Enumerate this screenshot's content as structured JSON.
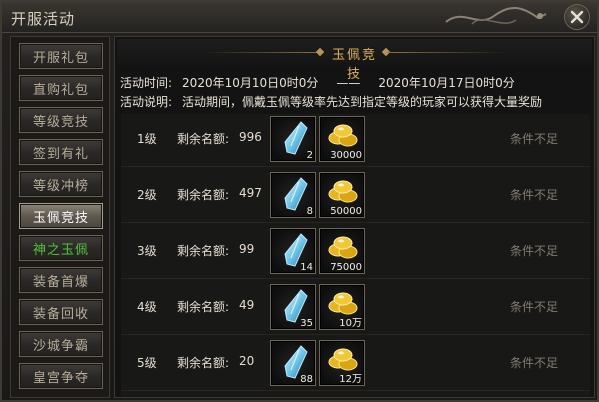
{
  "window": {
    "title": "开服活动"
  },
  "sidebar": {
    "items": [
      {
        "label": "开服礼包",
        "active": false,
        "highlight": false
      },
      {
        "label": "直购礼包",
        "active": false,
        "highlight": false
      },
      {
        "label": "等级竞技",
        "active": false,
        "highlight": false
      },
      {
        "label": "签到有礼",
        "active": false,
        "highlight": false
      },
      {
        "label": "等级冲榜",
        "active": false,
        "highlight": false
      },
      {
        "label": "玉佩竞技",
        "active": true,
        "highlight": false
      },
      {
        "label": "神之玉佩",
        "active": false,
        "highlight": true
      },
      {
        "label": "装备首爆",
        "active": false,
        "highlight": false
      },
      {
        "label": "装备回收",
        "active": false,
        "highlight": false
      },
      {
        "label": "沙城争霸",
        "active": false,
        "highlight": false
      },
      {
        "label": "皇宫争夺",
        "active": false,
        "highlight": false
      }
    ]
  },
  "main": {
    "banner_title": "玉佩竞技",
    "time_label": "活动时间:",
    "time_start": "2020年10月10日0时0分",
    "time_separator": "——",
    "time_end": "2020年10月17日0时0分",
    "desc_label": "活动说明:",
    "desc_text": "活动期间，佩戴玉佩等级率先达到指定等级的玩家可以获得大量奖励"
  },
  "rewards": [
    {
      "rank": "1级",
      "quota_label": "剩余名额:",
      "quota": "996",
      "jade_qty": "2",
      "gold_qty": "30000",
      "status": "条件不足"
    },
    {
      "rank": "2级",
      "quota_label": "剩余名额:",
      "quota": "497",
      "jade_qty": "8",
      "gold_qty": "50000",
      "status": "条件不足"
    },
    {
      "rank": "3级",
      "quota_label": "剩余名额:",
      "quota": "99",
      "jade_qty": "14",
      "gold_qty": "75000",
      "status": "条件不足"
    },
    {
      "rank": "4级",
      "quota_label": "剩余名额:",
      "quota": "49",
      "jade_qty": "35",
      "gold_qty": "10万",
      "status": "条件不足"
    },
    {
      "rank": "5级",
      "quota_label": "剩余名额:",
      "quota": "20",
      "jade_qty": "88",
      "gold_qty": "12万",
      "status": "条件不足"
    }
  ],
  "icons": {
    "close": "close-icon",
    "jade_item": "jade-pendant-icon",
    "gold_item": "gold-ingot-icon",
    "ornament": "dragon-ornament-icon"
  },
  "colors": {
    "active_tab": "#8c8578",
    "highlight_text": "#53c23a",
    "banner_title": "#e0b15a",
    "status_text": "#837c6f"
  }
}
